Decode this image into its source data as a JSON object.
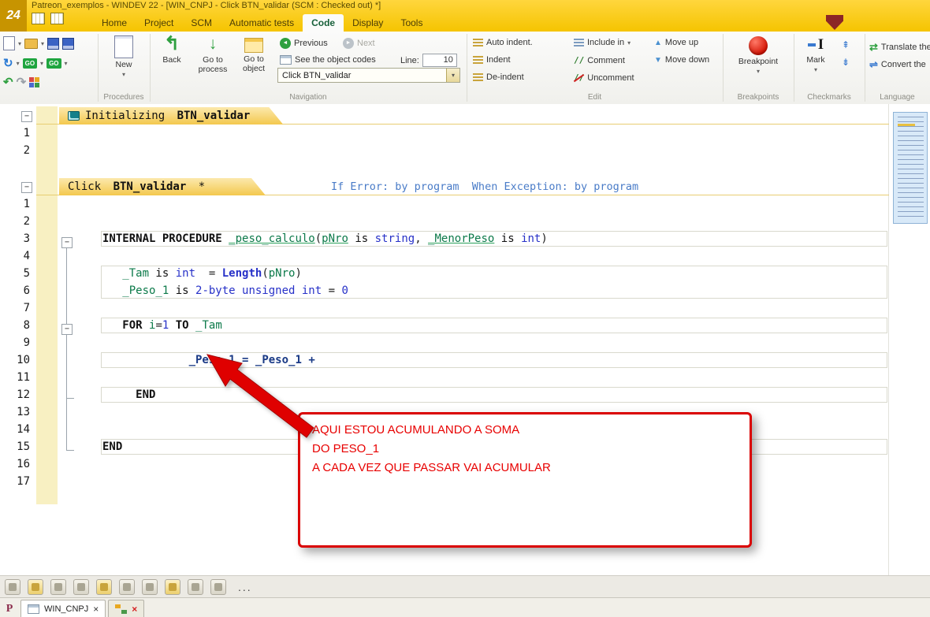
{
  "window": {
    "title": "Patreon_exemplos - WINDEV 22 - [WIN_CNPJ - Click BTN_validar (SCM : Checked out) *]",
    "logo": "24"
  },
  "menu_tabs": [
    {
      "label": "Home"
    },
    {
      "label": "Project"
    },
    {
      "label": "SCM"
    },
    {
      "label": "Automatic tests"
    },
    {
      "label": "Code"
    },
    {
      "label": "Display"
    },
    {
      "label": "Tools"
    }
  ],
  "ribbon": {
    "new_label": "New",
    "back_label": "Back",
    "goto_process_label": "Go to process",
    "goto_object_label": "Go to object",
    "previous_label": "Previous",
    "next_label": "Next",
    "see_object_codes_label": "See the object codes",
    "line_label": "Line:",
    "line_value": "10",
    "navigation_combo_value": "Click BTN_validar",
    "auto_indent_label": "Auto indent.",
    "indent_label": "Indent",
    "deindent_label": "De-indent",
    "include_in_label": "Include in",
    "comment_label": "Comment",
    "uncomment_label": "Uncomment",
    "move_up_label": "Move up",
    "move_down_label": "Move down",
    "breakpoint_label": "Breakpoint",
    "mark_label": "Mark",
    "translate_label": "Translate the",
    "convert_label": "Convert the",
    "groups": {
      "procedures": "Procedures",
      "navigation": "Navigation",
      "edit": "Edit",
      "breakpoints": "Breakpoints",
      "checkmarks": "Checkmarks",
      "language": "Language"
    }
  },
  "icons": {
    "dropdown": "▾",
    "close": "×",
    "go": "GO",
    "comment_glyph": "//",
    "ellipsis": "...",
    "p_logo": "P",
    "back_arrow": "↰",
    "goto_process_arrow": "↓",
    "previous_arrow": "◄",
    "next_arrow": "►",
    "undo": "↶",
    "redo": "↷",
    "sync": "↻",
    "move_up_glyph": "▲",
    "move_down_glyph": "▼",
    "promote": "⇞",
    "demote": "⇟",
    "translate_glyph": "⇄",
    "convert_glyph": "⇌",
    "minus": "−",
    "mark_cursor": "I"
  },
  "colors": {
    "titlebar_yellow": "#f5c400",
    "section_tab_yellow": "#f3c84e",
    "breakpoint_red": "#d41404",
    "annotation_red": "#e00000",
    "variable_green": "#0c7a4a",
    "type_blue": "#2731c8"
  },
  "editor": {
    "sections": [
      {
        "title_prefix": "Initializing ",
        "title_bold": "BTN_validar",
        "title_suffix": "",
        "subtitle": "",
        "has_icon": true,
        "lines": [
          {
            "n": "1",
            "tokens": []
          },
          {
            "n": "2",
            "tokens": []
          }
        ]
      },
      {
        "title_prefix": "Click ",
        "title_bold": "BTN_validar",
        "title_suffix": " *",
        "subtitle": "If Error: by program  When Exception: by program",
        "has_icon": false,
        "lines": [
          {
            "n": "1",
            "tokens": []
          },
          {
            "n": "2",
            "tokens": []
          },
          {
            "n": "3",
            "box": "full",
            "indent": 0,
            "tokens": [
              {
                "t": "INTERNAL PROCEDURE ",
                "c": "kwb"
              },
              {
                "t": "_peso_calculo",
                "c": "varu"
              },
              {
                "t": "(",
                "c": "pl"
              },
              {
                "t": "pNro",
                "c": "varu"
              },
              {
                "t": " is ",
                "c": "kw"
              },
              {
                "t": "string",
                "c": "ty"
              },
              {
                "t": ", ",
                "c": "pl"
              },
              {
                "t": "_MenorPeso",
                "c": "varu"
              },
              {
                "t": " is ",
                "c": "kw"
              },
              {
                "t": "int",
                "c": "ty"
              },
              {
                "t": ")",
                "c": "pl"
              }
            ]
          },
          {
            "n": "4",
            "tokens": []
          },
          {
            "n": "5",
            "box": "top",
            "indent": 3,
            "tokens": [
              {
                "t": "_Tam",
                "c": "var"
              },
              {
                "t": " is ",
                "c": "kw"
              },
              {
                "t": "int",
                "c": "ty"
              },
              {
                "t": "  = ",
                "c": "pl"
              },
              {
                "t": "Length",
                "c": "fn"
              },
              {
                "t": "(",
                "c": "pl"
              },
              {
                "t": "pNro",
                "c": "var"
              },
              {
                "t": ")",
                "c": "pl"
              }
            ]
          },
          {
            "n": "6",
            "box": "bottom",
            "indent": 3,
            "tokens": [
              {
                "t": "_Peso_1",
                "c": "var"
              },
              {
                "t": " is ",
                "c": "kw"
              },
              {
                "t": "2-byte unsigned int",
                "c": "ty"
              },
              {
                "t": " = ",
                "c": "pl"
              },
              {
                "t": "0",
                "c": "num"
              }
            ]
          },
          {
            "n": "7",
            "tokens": []
          },
          {
            "n": "8",
            "box": "full",
            "indent": 3,
            "tokens": [
              {
                "t": "FOR ",
                "c": "kwb"
              },
              {
                "t": "i",
                "c": "var"
              },
              {
                "t": "=",
                "c": "pl"
              },
              {
                "t": "1",
                "c": "num"
              },
              {
                "t": " TO ",
                "c": "kwb"
              },
              {
                "t": "_Tam",
                "c": "var"
              }
            ]
          },
          {
            "n": "9",
            "tokens": []
          },
          {
            "n": "10",
            "box": "full",
            "indent": 13,
            "tokens": [
              {
                "t": "_Peso_1",
                "c": "varb"
              },
              {
                "t": " = ",
                "c": "plb"
              },
              {
                "t": "_Peso_1",
                "c": "varb"
              },
              {
                "t": " +",
                "c": "plb"
              }
            ]
          },
          {
            "n": "11",
            "tokens": []
          },
          {
            "n": "12",
            "box": "full",
            "indent": 5,
            "tokens": [
              {
                "t": "END",
                "c": "kwb"
              }
            ]
          },
          {
            "n": "13",
            "tokens": []
          },
          {
            "n": "14",
            "tokens": []
          },
          {
            "n": "15",
            "box": "full",
            "indent": 0,
            "tokens": [
              {
                "t": "END",
                "c": "kwb"
              }
            ]
          },
          {
            "n": "16",
            "tokens": []
          },
          {
            "n": "17",
            "tokens": []
          }
        ]
      }
    ]
  },
  "annotation": {
    "lines": [
      "AQUI ESTOU ACUMULANDO A SOMA",
      "DO PESO_1",
      "A CADA VEZ QUE PASSAR VAI ACUMULAR"
    ]
  },
  "bottom_toolbar": {
    "icons": [
      "element-icon-1",
      "element-icon-2",
      "element-icon-3",
      "element-icon-4",
      "element-icon-5",
      "element-icon-6",
      "element-icon-7",
      "element-icon-8",
      "element-icon-9",
      "element-icon-10"
    ]
  },
  "bottom_bar": {
    "tabs": [
      {
        "label": "WIN_CNPJ"
      },
      {
        "label": ""
      }
    ]
  }
}
